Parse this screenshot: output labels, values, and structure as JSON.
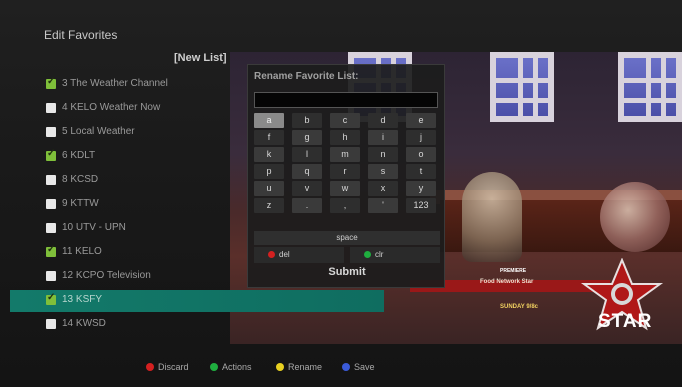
{
  "header": {
    "title": "Edit Favorites"
  },
  "list": {
    "name": "[New List]",
    "items": [
      {
        "label": "3 The Weather Channel",
        "checked": true
      },
      {
        "label": "4 KELO Weather Now",
        "checked": false
      },
      {
        "label": "5 Local Weather",
        "checked": false
      },
      {
        "label": "6 KDLT",
        "checked": true
      },
      {
        "label": "8 KCSD",
        "checked": false
      },
      {
        "label": "9 KTTW",
        "checked": false
      },
      {
        "label": "10 UTV - UPN",
        "checked": false
      },
      {
        "label": "11 KELO",
        "checked": true
      },
      {
        "label": "12 KCPO Television",
        "checked": false
      },
      {
        "label": "13 KSFY",
        "checked": true,
        "selected": true
      },
      {
        "label": "14 KWSD",
        "checked": false
      }
    ]
  },
  "video": {
    "banner": "Food Network Star",
    "schedule": "SUNDAY 9/8c",
    "promo": "PREMIERE",
    "logo_text": "STAR"
  },
  "dialog": {
    "title": "Rename Favorite List:",
    "input_value": "",
    "keys": [
      [
        "a",
        "b",
        "c",
        "d",
        "e"
      ],
      [
        "f",
        "g",
        "h",
        "i",
        "j"
      ],
      [
        "k",
        "l",
        "m",
        "n",
        "o"
      ],
      [
        "p",
        "q",
        "r",
        "s",
        "t"
      ],
      [
        "u",
        "v",
        "w",
        "x",
        "y"
      ],
      [
        "z",
        ".",
        ",",
        "'",
        "123"
      ]
    ],
    "active_key": "a",
    "space_label": "space",
    "del_label": "del",
    "clr_label": "clr",
    "submit_label": "Submit",
    "colors": {
      "del": "#d42020",
      "clr": "#1fae3f"
    }
  },
  "legend": [
    {
      "label": "Discard",
      "color": "#d42020"
    },
    {
      "label": "Actions",
      "color": "#1fae3f"
    },
    {
      "label": "Rename",
      "color": "#e8d020"
    },
    {
      "label": "Save",
      "color": "#3a5ad8"
    }
  ]
}
